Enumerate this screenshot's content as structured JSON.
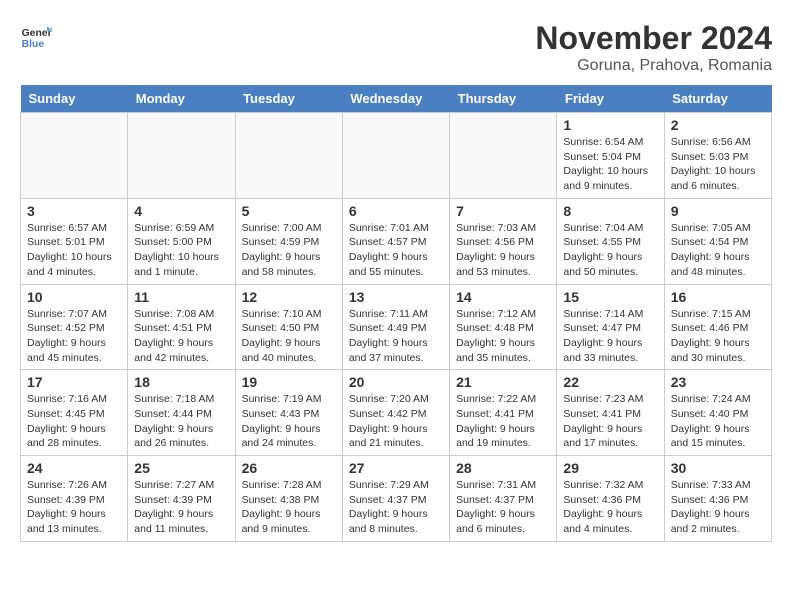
{
  "logo": {
    "line1": "General",
    "line2": "Blue"
  },
  "header": {
    "month": "November 2024",
    "location": "Goruna, Prahova, Romania"
  },
  "weekdays": [
    "Sunday",
    "Monday",
    "Tuesday",
    "Wednesday",
    "Thursday",
    "Friday",
    "Saturday"
  ],
  "weeks": [
    [
      {
        "day": "",
        "info": ""
      },
      {
        "day": "",
        "info": ""
      },
      {
        "day": "",
        "info": ""
      },
      {
        "day": "",
        "info": ""
      },
      {
        "day": "",
        "info": ""
      },
      {
        "day": "1",
        "info": "Sunrise: 6:54 AM\nSunset: 5:04 PM\nDaylight: 10 hours and 9 minutes."
      },
      {
        "day": "2",
        "info": "Sunrise: 6:56 AM\nSunset: 5:03 PM\nDaylight: 10 hours and 6 minutes."
      }
    ],
    [
      {
        "day": "3",
        "info": "Sunrise: 6:57 AM\nSunset: 5:01 PM\nDaylight: 10 hours and 4 minutes."
      },
      {
        "day": "4",
        "info": "Sunrise: 6:59 AM\nSunset: 5:00 PM\nDaylight: 10 hours and 1 minute."
      },
      {
        "day": "5",
        "info": "Sunrise: 7:00 AM\nSunset: 4:59 PM\nDaylight: 9 hours and 58 minutes."
      },
      {
        "day": "6",
        "info": "Sunrise: 7:01 AM\nSunset: 4:57 PM\nDaylight: 9 hours and 55 minutes."
      },
      {
        "day": "7",
        "info": "Sunrise: 7:03 AM\nSunset: 4:56 PM\nDaylight: 9 hours and 53 minutes."
      },
      {
        "day": "8",
        "info": "Sunrise: 7:04 AM\nSunset: 4:55 PM\nDaylight: 9 hours and 50 minutes."
      },
      {
        "day": "9",
        "info": "Sunrise: 7:05 AM\nSunset: 4:54 PM\nDaylight: 9 hours and 48 minutes."
      }
    ],
    [
      {
        "day": "10",
        "info": "Sunrise: 7:07 AM\nSunset: 4:52 PM\nDaylight: 9 hours and 45 minutes."
      },
      {
        "day": "11",
        "info": "Sunrise: 7:08 AM\nSunset: 4:51 PM\nDaylight: 9 hours and 42 minutes."
      },
      {
        "day": "12",
        "info": "Sunrise: 7:10 AM\nSunset: 4:50 PM\nDaylight: 9 hours and 40 minutes."
      },
      {
        "day": "13",
        "info": "Sunrise: 7:11 AM\nSunset: 4:49 PM\nDaylight: 9 hours and 37 minutes."
      },
      {
        "day": "14",
        "info": "Sunrise: 7:12 AM\nSunset: 4:48 PM\nDaylight: 9 hours and 35 minutes."
      },
      {
        "day": "15",
        "info": "Sunrise: 7:14 AM\nSunset: 4:47 PM\nDaylight: 9 hours and 33 minutes."
      },
      {
        "day": "16",
        "info": "Sunrise: 7:15 AM\nSunset: 4:46 PM\nDaylight: 9 hours and 30 minutes."
      }
    ],
    [
      {
        "day": "17",
        "info": "Sunrise: 7:16 AM\nSunset: 4:45 PM\nDaylight: 9 hours and 28 minutes."
      },
      {
        "day": "18",
        "info": "Sunrise: 7:18 AM\nSunset: 4:44 PM\nDaylight: 9 hours and 26 minutes."
      },
      {
        "day": "19",
        "info": "Sunrise: 7:19 AM\nSunset: 4:43 PM\nDaylight: 9 hours and 24 minutes."
      },
      {
        "day": "20",
        "info": "Sunrise: 7:20 AM\nSunset: 4:42 PM\nDaylight: 9 hours and 21 minutes."
      },
      {
        "day": "21",
        "info": "Sunrise: 7:22 AM\nSunset: 4:41 PM\nDaylight: 9 hours and 19 minutes."
      },
      {
        "day": "22",
        "info": "Sunrise: 7:23 AM\nSunset: 4:41 PM\nDaylight: 9 hours and 17 minutes."
      },
      {
        "day": "23",
        "info": "Sunrise: 7:24 AM\nSunset: 4:40 PM\nDaylight: 9 hours and 15 minutes."
      }
    ],
    [
      {
        "day": "24",
        "info": "Sunrise: 7:26 AM\nSunset: 4:39 PM\nDaylight: 9 hours and 13 minutes."
      },
      {
        "day": "25",
        "info": "Sunrise: 7:27 AM\nSunset: 4:39 PM\nDaylight: 9 hours and 11 minutes."
      },
      {
        "day": "26",
        "info": "Sunrise: 7:28 AM\nSunset: 4:38 PM\nDaylight: 9 hours and 9 minutes."
      },
      {
        "day": "27",
        "info": "Sunrise: 7:29 AM\nSunset: 4:37 PM\nDaylight: 9 hours and 8 minutes."
      },
      {
        "day": "28",
        "info": "Sunrise: 7:31 AM\nSunset: 4:37 PM\nDaylight: 9 hours and 6 minutes."
      },
      {
        "day": "29",
        "info": "Sunrise: 7:32 AM\nSunset: 4:36 PM\nDaylight: 9 hours and 4 minutes."
      },
      {
        "day": "30",
        "info": "Sunrise: 7:33 AM\nSunset: 4:36 PM\nDaylight: 9 hours and 2 minutes."
      }
    ]
  ]
}
